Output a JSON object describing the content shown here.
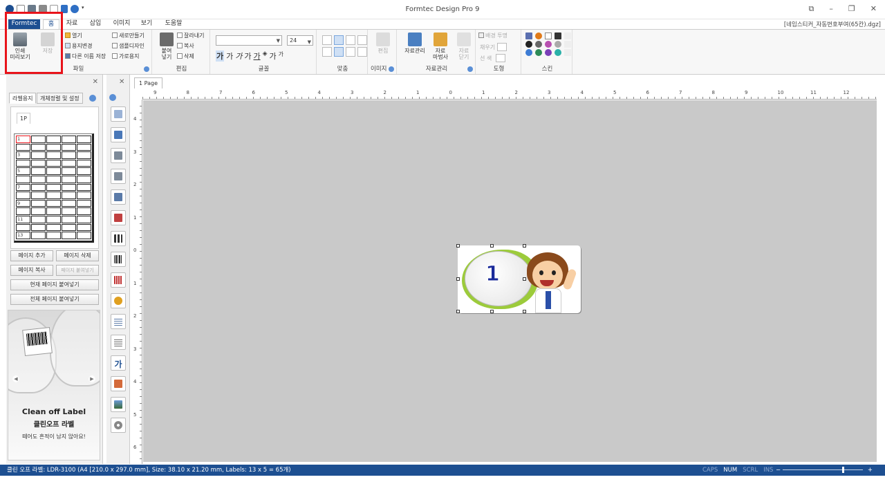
{
  "window": {
    "title": "Formtec Design Pro 9",
    "file_name": "[네임스티커_자동번호부여(65칸).dgz]"
  },
  "tabs": [
    {
      "label": "Formtec"
    },
    {
      "label": "홈"
    },
    {
      "label": "자료"
    },
    {
      "label": "삽입"
    },
    {
      "label": "이미지"
    },
    {
      "label": "보기"
    },
    {
      "label": "도움말"
    }
  ],
  "ribbon": {
    "file": {
      "group_label": "파일",
      "print_preview": "인쇄\n미리보기",
      "save": "저장",
      "open": "열기",
      "change_paper": "용지변경",
      "save_as": "다른 이름 저장",
      "new": "새로만들기",
      "sample_design": "샘플디자인",
      "landscape": "가로용지"
    },
    "edit": {
      "group_label": "편집",
      "paste": "붙여\n넣기",
      "cut": "잘라내기",
      "copy": "복사",
      "delete": "삭제"
    },
    "font": {
      "group_label": "글꼴",
      "font_name": "",
      "font_size": "24",
      "styles": [
        "가",
        "가",
        "가",
        "가",
        "가",
        "가",
        "가"
      ]
    },
    "align": {
      "group_label": "맞춤"
    },
    "image": {
      "group_label": "이미지",
      "edit": "편집"
    },
    "data": {
      "group_label": "자료관리",
      "manage": "자료관리",
      "wizard": "자료\n마법사",
      "close": "자료\n닫기"
    },
    "shape": {
      "group_label": "도형",
      "transparent_bg": "배경 투명",
      "fill": "채우기",
      "line_color": "선 색"
    },
    "skin": {
      "group_label": "스킨"
    }
  },
  "left_panel": {
    "tabs": [
      "라벨용지",
      "개체정렬 및 설정"
    ],
    "page_tab": "1P",
    "row_numbers": [
      "1",
      "3",
      "5",
      "7",
      "9",
      "11",
      "13"
    ],
    "buttons": {
      "add_page": "페이지 추가",
      "delete_page": "페이지 삭제",
      "copy_page": "페이지 복사",
      "paste_page": "페이지 붙여넣기",
      "paste_current": "현재 페이지 붙여넣기",
      "paste_all": "전체 페이지 붙여넣기"
    },
    "ad": {
      "brand": "Clean off Label",
      "title": "클린오프 라벨",
      "desc": "떼어도 흔적이 남지 않아요!"
    }
  },
  "canvas": {
    "page_tab": "1 Page",
    "h_ruler": [
      "9",
      "8",
      "7",
      "6",
      "5",
      "4",
      "3",
      "2",
      "1",
      "0",
      "1",
      "2",
      "3",
      "4",
      "5",
      "6",
      "7",
      "8",
      "9",
      "10",
      "11",
      "12"
    ],
    "v_ruler": [
      "4",
      "3",
      "2",
      "1",
      "0",
      "1",
      "2",
      "3",
      "4",
      "5",
      "6"
    ],
    "label_number": "1"
  },
  "statusbar": {
    "text": "클린 오프 라벨: LDR-3100 (A4 [210.0 x 297.0 mm], Size: 38.10 x 21.20 mm,  Labels: 13 x 5 = 65개)",
    "caps": "CAPS",
    "num": "NUM",
    "scrl": "SCRL",
    "ins": "INS",
    "zoom_minus": "−",
    "zoom_plus": "+",
    "zoom_level": 0.74
  },
  "colors": {
    "accent": "#1d4f91",
    "highlight": "#e8131a",
    "workspace": "#c9c9c9"
  }
}
